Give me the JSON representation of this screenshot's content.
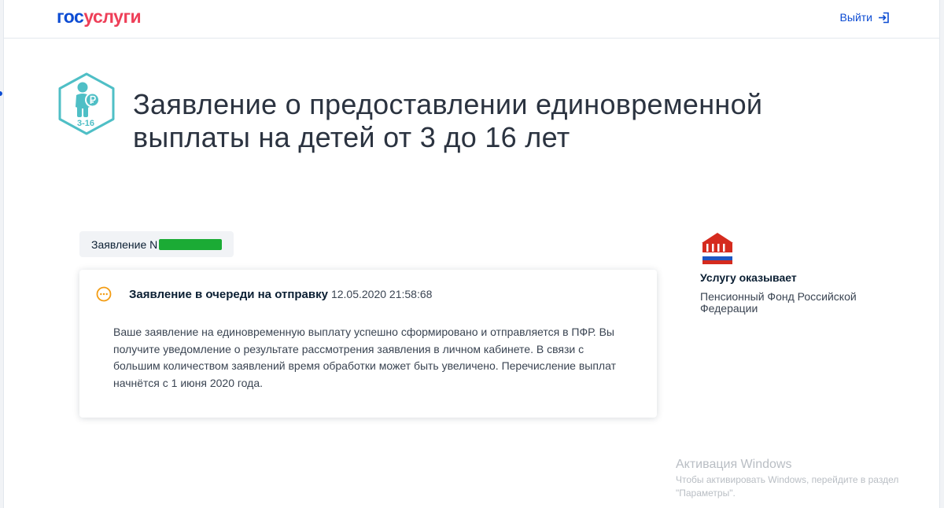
{
  "header": {
    "logo_part1": "гос",
    "logo_part2": "услуги",
    "logout_label": "Выйти",
    "logout_icon": "logout-icon"
  },
  "service": {
    "icon": "child-payment-icon",
    "icon_label": "3-16",
    "title": "Заявление о предоставлении единовременной выплаты на детей от 3 до 16 лет"
  },
  "application": {
    "number_label": "Заявление N"
  },
  "status": {
    "icon": "pending-dots-icon",
    "title": "Заявление в очереди на отправку",
    "datetime": "12.05.2020 21:58:68",
    "message": "Ваше заявление на единовременную выплату успешно сформировано и отправляется в ПФР. Вы получите уведомление о результате рассмотрения заявления в личном кабинете. В связи с большим количеством заявлений время обработки может быть увеличено. Перечисление выплат начнётся с 1 июня 2020 года."
  },
  "provider": {
    "logo": "pfr-logo",
    "label": "Услугу оказывает",
    "name": "Пенсионный Фонд Российской Федерации"
  },
  "windows_activation": {
    "title": "Активация Windows",
    "subtitle": "Чтобы активировать Windows, перейдите в раздел \"Параметры\"."
  },
  "colors": {
    "brand_blue": "#0d4cd3",
    "brand_red": "#ee3f58",
    "service_icon_teal": "#4fbfc6",
    "status_orange": "#f39c12",
    "redaction_green": "#1bab35"
  }
}
